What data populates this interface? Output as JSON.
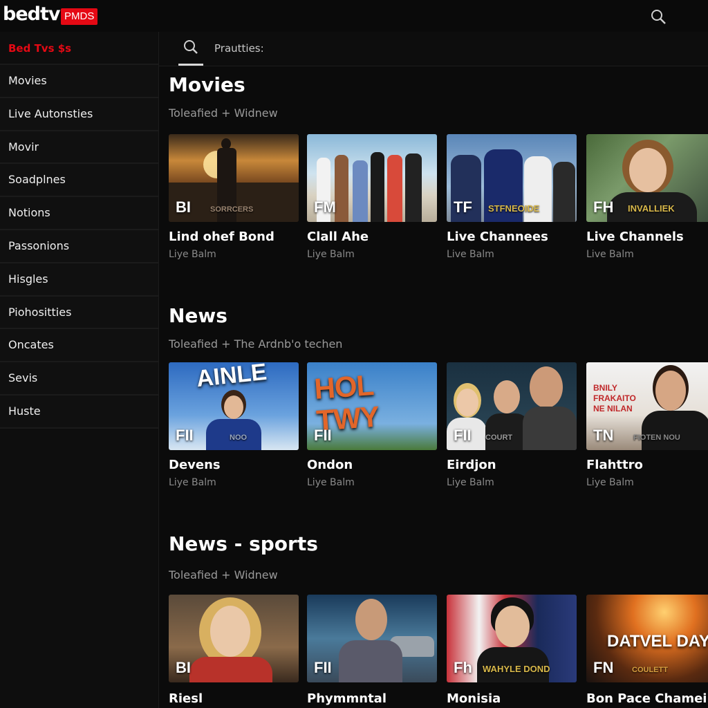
{
  "app": {
    "logo": "bedtv",
    "badge": "PMDS",
    "brand_color": "#e50914"
  },
  "topbar": {
    "search_icon": "search-icon"
  },
  "sidebar": {
    "header": "Bed Tvs $s",
    "items": [
      {
        "label": "Movies"
      },
      {
        "label": "Live Autonsties"
      },
      {
        "label": "Movir"
      },
      {
        "label": "Soadplnes"
      },
      {
        "label": "Notions"
      },
      {
        "label": "Passonions"
      },
      {
        "label": "Hisgles"
      },
      {
        "label": "Piohositties"
      },
      {
        "label": "Oncates"
      },
      {
        "label": "Sevis"
      },
      {
        "label": "Huste"
      }
    ]
  },
  "search": {
    "placeholder": "Prautties:"
  },
  "sections": [
    {
      "title": "Movies",
      "subtitle": "Toleafied + Widnew",
      "cards": [
        {
          "code": "BI",
          "overlay": "SORRCERS",
          "title": "Lind ohef Bond",
          "sub": "Liye Balm"
        },
        {
          "code": "FM",
          "overlay": "",
          "title": "Clall Ahe",
          "sub": "Liye Balm"
        },
        {
          "code": "TF",
          "overlay": "STFNEOIDE",
          "title": "Live Channees",
          "sub": "Live Balm"
        },
        {
          "code": "FH",
          "overlay": "INVALLIEK",
          "title": "Live Channels",
          "sub": "Live Balm"
        }
      ]
    },
    {
      "title": "News",
      "subtitle": "Toleafied + The Ardnb'o techen",
      "cards": [
        {
          "code": "FII",
          "overlay": "NOO",
          "headline": "AINLE",
          "title": "Devens",
          "sub": "Liye Balm"
        },
        {
          "code": "FII",
          "overlay": "",
          "headline": "HOL TWY",
          "title": "Ondon",
          "sub": "Liye Balm"
        },
        {
          "code": "FII",
          "overlay": "COURT",
          "headline": "",
          "title": "Eirdjon",
          "sub": "Liye Balm"
        },
        {
          "code": "TN",
          "overlay": "FIOTEN NOU",
          "headline": "BNILY FRAKAITO NE NILAN",
          "title": "Flahttro",
          "sub": "Liye Balm"
        }
      ]
    },
    {
      "title": "News - sports",
      "subtitle": "Toleafied + Widnew",
      "cards": [
        {
          "code": "BI",
          "overlay": "",
          "headline": "",
          "title": "Riesl",
          "sub": ""
        },
        {
          "code": "FII",
          "overlay": "",
          "headline": "",
          "title": "Phymmntal",
          "sub": ""
        },
        {
          "code": "Fh",
          "overlay": "WAHYLE DOND",
          "headline": "",
          "title": "Monisia",
          "sub": ""
        },
        {
          "code": "FN",
          "overlay": "COULETT",
          "headline": "DATVEL DAYL",
          "title": "Bon Pace Chameil",
          "sub": ""
        }
      ]
    }
  ]
}
